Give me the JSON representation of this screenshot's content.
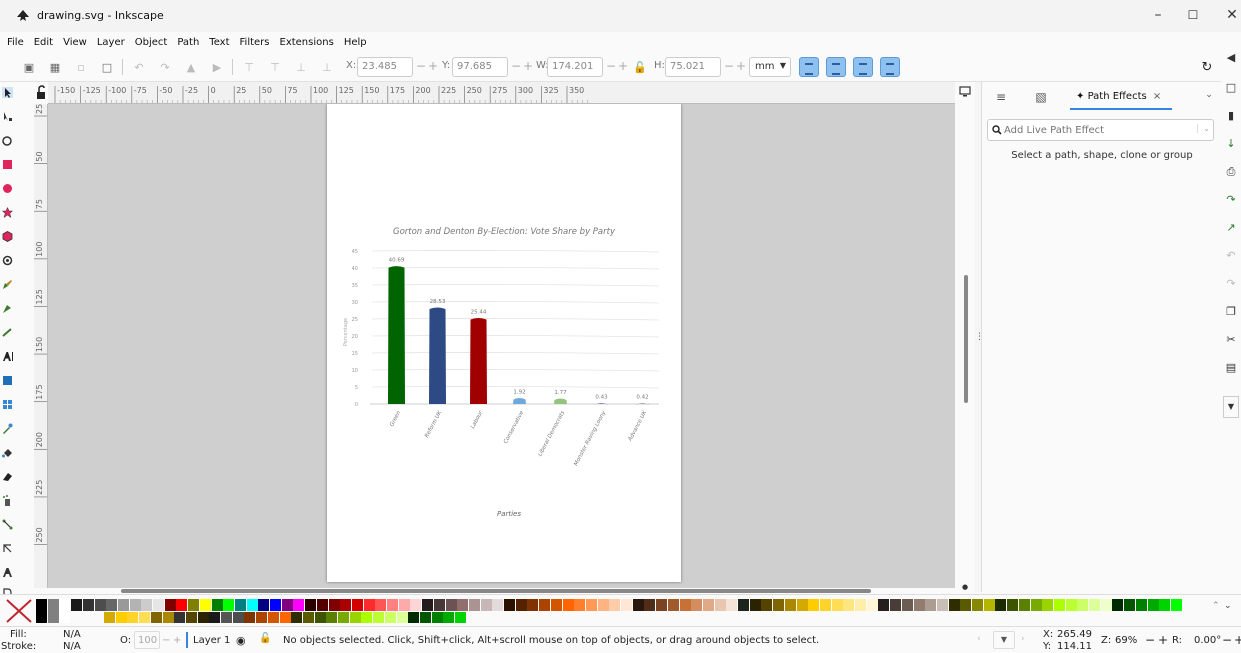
{
  "window": {
    "title": "drawing.svg - Inkscape",
    "controls": [
      "–",
      "☐",
      "✕"
    ]
  },
  "menu": [
    "File",
    "Edit",
    "View",
    "Layer",
    "Object",
    "Path",
    "Text",
    "Filters",
    "Extensions",
    "Help"
  ],
  "toolbar": {
    "x_label": "X:",
    "x_value": "23.485",
    "y_label": "Y:",
    "y_value": "97.685",
    "w_label": "W:",
    "w_value": "174.201",
    "h_label": "H:",
    "h_value": "75.021",
    "unit": "mm",
    "plus": "+",
    "minus": "−"
  },
  "ruler": {
    "top": [
      "-150",
      "-125",
      "-100",
      "-75",
      "-50",
      "-25",
      "0",
      "25",
      "50",
      "75",
      "100",
      "125",
      "150",
      "175",
      "200",
      "225",
      "250",
      "275",
      "300",
      "325",
      "350"
    ],
    "left": [
      "25",
      "50",
      "75",
      "100",
      "125",
      "150",
      "175",
      "200",
      "225",
      "250"
    ]
  },
  "panel": {
    "tab_label": "Path Effects",
    "tab_close": "×",
    "search_placeholder": "Add Live Path Effect",
    "message": "Select a path, shape, clone or group"
  },
  "status": {
    "fill_label": "Fill:",
    "fill_value": "N/A",
    "stroke_label": "Stroke:",
    "stroke_value": "N/A",
    "opacity_label": "O:",
    "opacity_value": "100",
    "layer": "Layer 1",
    "message": "No objects selected. Click, Shift+click, Alt+scroll mouse on top of objects, or drag around objects to select.",
    "x_label": "X:",
    "x_value": "265.49",
    "y_label": "Y:",
    "y_value": "114.11",
    "zoom_label": "Z:",
    "zoom_value": "69%",
    "rotate_label": "R:",
    "rotate_value": "0.00°"
  },
  "palette": {
    "swatches": [
      "#000000",
      "#808080",
      "#ffffff",
      "#1a1a1a",
      "#333333",
      "#4d4d4d",
      "#666666",
      "#999999",
      "#b3b3b3",
      "#cccccc",
      "#e6e6e6",
      "#800000",
      "#ff0000",
      "#808000",
      "#ffff00",
      "#008000",
      "#00ff00",
      "#008080",
      "#00ffff",
      "#000080",
      "#0000ff",
      "#800080",
      "#ff00ff",
      "#2b0000",
      "#550000",
      "#800000",
      "#aa0000",
      "#d40000",
      "#ff2a2a",
      "#ff5555",
      "#ff8080",
      "#ffaaaa",
      "#ffd5d5",
      "#241c1c",
      "#483737",
      "#6c5353",
      "#916f6f",
      "#ac9393",
      "#c8b7b7",
      "#e3dbdb",
      "#2b1100",
      "#552200",
      "#803300",
      "#aa4400",
      "#d45500",
      "#ff6600",
      "#ff7f2a",
      "#ff9955",
      "#ffb380",
      "#ffccaa",
      "#ffe6d5",
      "#28170b",
      "#502d16",
      "#784421",
      "#a05a2c",
      "#c87137",
      "#d38d5f",
      "#deaa87",
      "#e9c6af",
      "#f4e3d7",
      "#1c241c",
      "#2b2200",
      "#554400",
      "#806600",
      "#aa8800",
      "#d4aa00",
      "#ffcc00",
      "#ffd42a",
      "#ffdd55",
      "#ffe680",
      "#ffeeaa",
      "#fff6d5",
      "#241f1c",
      "#483e37",
      "#6c5d53",
      "#917c6f",
      "#ac9d93",
      "#c8beb7",
      "#2d2d00",
      "#5a5a00",
      "#888800",
      "#b5b500",
      "#1e2b00",
      "#3d5500",
      "#5a8000",
      "#78aa00",
      "#99d400",
      "#aaff00",
      "#bbff33",
      "#ccff66",
      "#ddff99",
      "#eeffcc",
      "#002b00",
      "#005500",
      "#008000",
      "#00aa00",
      "#00d400",
      "#00ff00"
    ],
    "swatch_bottom": [
      "#d4aa00",
      "#ffcc00",
      "#ffd42a",
      "#ffdd55",
      "#806600",
      "#aa8800",
      "#333333",
      "#554400",
      "#2b2200",
      "#1a1a1a",
      "#555555",
      "#4d4d4d",
      "#803300",
      "#aa4400",
      "#d45500",
      "#ff6600",
      "#2d2d00",
      "#5a5a00",
      "#3d5500",
      "#5a8000",
      "#78aa00",
      "#99d400",
      "#aaff00",
      "#bbff33",
      "#ccff66",
      "#ddff99",
      "#002b00",
      "#005500",
      "#008000",
      "#00aa00",
      "#00d400"
    ]
  },
  "chart_data": {
    "type": "bar",
    "title": "Gorton and Denton By-Election: Vote Share by Party",
    "xlabel": "Parties",
    "ylabel": "Percentage",
    "categories": [
      "Green",
      "Reform UK",
      "Labour",
      "Conservative",
      "Liberal Democrats",
      "Monster Raving Loony",
      "Advance UK"
    ],
    "values": [
      40.69,
      28.53,
      25.44,
      1.92,
      1.77,
      0.43,
      0.42
    ],
    "labels": [
      "40.69",
      "28.53",
      "25.44",
      "1.92",
      "1.77",
      "0.43",
      "0.42"
    ],
    "colors": [
      "#006400",
      "#2e4a84",
      "#a10000",
      "#6fa8dc",
      "#93c47d",
      "#8e7cc3",
      "#999999"
    ],
    "ylim": [
      0,
      45
    ],
    "yticks": [
      "0",
      "5",
      "10",
      "15",
      "20",
      "25",
      "30",
      "35",
      "40",
      "45"
    ],
    "grid": true,
    "legend": "none"
  }
}
